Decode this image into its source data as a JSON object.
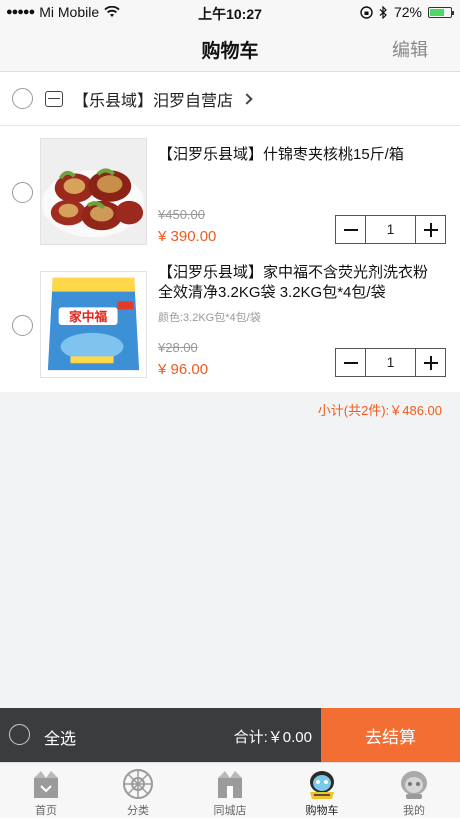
{
  "status": {
    "carrier": "Mi Mobile",
    "time": "上午10:27",
    "battery": "72%",
    "battery_level": 0.72
  },
  "nav": {
    "title": "购物车",
    "edit": "编辑"
  },
  "store": {
    "name": "【乐县域】汨罗自营店"
  },
  "items": [
    {
      "name": "【汨罗乐县域】什锦枣夹核桃15斤/箱",
      "spec": "",
      "old_price": "¥450.00",
      "price": "¥ 390.00",
      "qty": "1",
      "image_icon": "dates-walnut-product"
    },
    {
      "name": "【汨罗乐县域】家中福不含荧光剂洗衣粉全效清净3.2KG袋 3.2KG包*4包/袋",
      "spec": "颜色:3.2KG包*4包/袋",
      "old_price": "¥28.00",
      "price": "¥ 96.00",
      "qty": "1",
      "image_icon": "detergent-bag-product",
      "brand_text": "家中福"
    }
  ],
  "subtotal": "小计(共2件):￥486.00",
  "checkout": {
    "select_all": "全选",
    "total": "合计:￥0.00",
    "go": "去结算"
  },
  "tabs": [
    {
      "label": "首页",
      "icon": "home-box-icon"
    },
    {
      "label": "分类",
      "icon": "category-wheel-icon"
    },
    {
      "label": "同城店",
      "icon": "city-store-icon"
    },
    {
      "label": "购物车",
      "icon": "cart-mascot-icon",
      "active": true
    },
    {
      "label": "我的",
      "icon": "profile-mascot-icon"
    }
  ],
  "colors": {
    "accent": "#f36e33",
    "price": "#f05a1e",
    "checkout_bar": "#3b3c3e"
  }
}
